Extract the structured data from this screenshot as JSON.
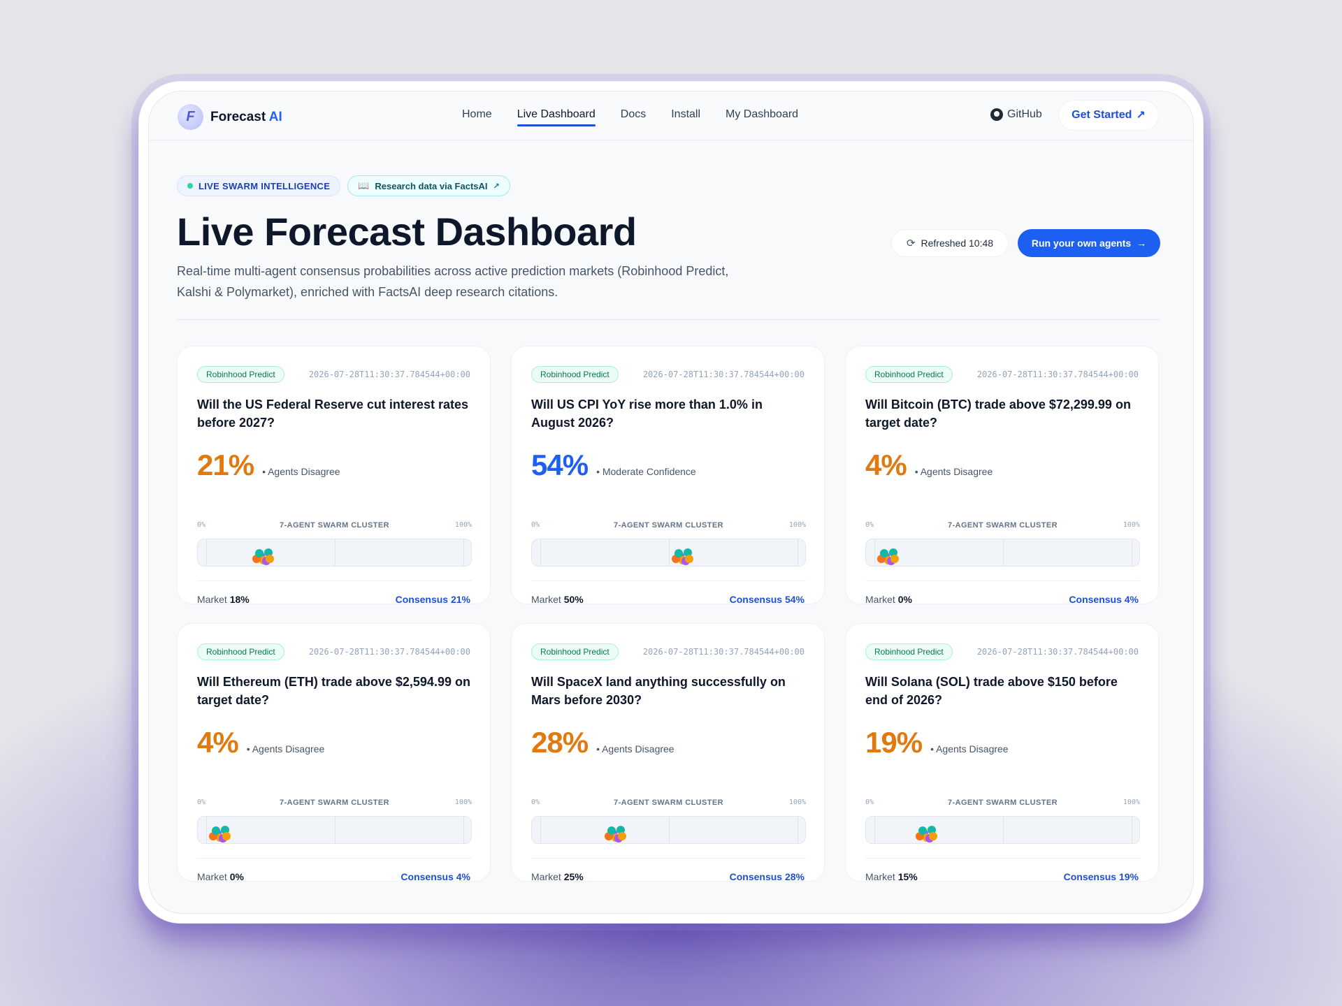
{
  "nav": {
    "logo_word": "Forecast",
    "logo_accent": "AI",
    "links": [
      "Home",
      "Live Dashboard",
      "Docs",
      "Install",
      "My Dashboard"
    ],
    "github": "GitHub",
    "get_started": "Get Started",
    "get_started_arrow": "↗"
  },
  "hero": {
    "chip_live": "LIVE SWARM INTELLIGENCE",
    "chip_research": "Research data via FactsAI",
    "title": "Live Forecast Dashboard",
    "subtitle": "Real-time multi-agent consensus probabilities across active prediction markets (Robinhood Predict, Kalshi & Polymarket), enriched with FactsAI deep research citations.",
    "refreshed": "Refreshed 10:48",
    "run_button": "Run your own agents",
    "run_arrow": "→"
  },
  "colors": {
    "accent": "#1d5ff0",
    "disagree": "#e07a0f",
    "agent_dots": [
      "#a855f7",
      "#14b8a6",
      "#f59e0b",
      "#f97316"
    ]
  },
  "cluster": {
    "label": "7-AGENT SWARM CLUSTER",
    "min": "0%",
    "max": "100%",
    "market_label": "Market",
    "consensus_label": "Consensus"
  },
  "cards": [
    {
      "source": "Robinhood Predict",
      "timestamp": "2026-07-28T11:30:37.784544+00:00",
      "question": "Will the US Federal Reserve cut interest rates before 2027?",
      "probability": "21%",
      "probability_value": 21,
      "confidence": "• Agents Disagree",
      "tone": "orange",
      "market": "18%",
      "consensus": "21%"
    },
    {
      "source": "Robinhood Predict",
      "timestamp": "2026-07-28T11:30:37.784544+00:00",
      "question": "Will US CPI YoY rise more than 1.0% in August 2026?",
      "probability": "54%",
      "probability_value": 54,
      "confidence": "• Moderate Confidence",
      "tone": "blue",
      "market": "50%",
      "consensus": "54%"
    },
    {
      "source": "Robinhood Predict",
      "timestamp": "2026-07-28T11:30:37.784544+00:00",
      "question": "Will Bitcoin (BTC) trade above $72,299.99 on target date?",
      "probability": "4%",
      "probability_value": 4,
      "confidence": "• Agents Disagree",
      "tone": "orange",
      "market": "0%",
      "consensus": "4%"
    },
    {
      "source": "Robinhood Predict",
      "timestamp": "2026-07-28T11:30:37.784544+00:00",
      "question": "Will Ethereum (ETH) trade above $2,594.99 on target date?",
      "probability": "4%",
      "probability_value": 4,
      "confidence": "• Agents Disagree",
      "tone": "orange",
      "market": "0%",
      "consensus": "4%"
    },
    {
      "source": "Robinhood Predict",
      "timestamp": "2026-07-28T11:30:37.784544+00:00",
      "question": "Will SpaceX land anything successfully on Mars before 2030?",
      "probability": "28%",
      "probability_value": 28,
      "confidence": "• Agents Disagree",
      "tone": "orange",
      "market": "25%",
      "consensus": "28%"
    },
    {
      "source": "Robinhood Predict",
      "timestamp": "2026-07-28T11:30:37.784544+00:00",
      "question": "Will Solana (SOL) trade above $150 before end of 2026?",
      "probability": "19%",
      "probability_value": 19,
      "confidence": "• Agents Disagree",
      "tone": "orange",
      "market": "15%",
      "consensus": "19%"
    }
  ]
}
